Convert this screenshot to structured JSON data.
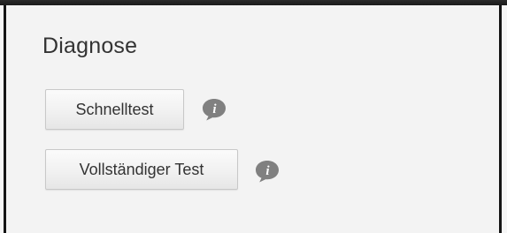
{
  "diagnostics": {
    "title": "Diagnose",
    "quick_test": {
      "label": "Schnelltest",
      "info_icon": "info-speech-bubble-icon"
    },
    "full_test": {
      "label": "Vollständiger Test",
      "info_icon": "info-speech-bubble-icon"
    }
  },
  "colors": {
    "background": "#f3f3f3",
    "text": "#333333",
    "icon": "#808080",
    "border": "#c8c8c8"
  }
}
